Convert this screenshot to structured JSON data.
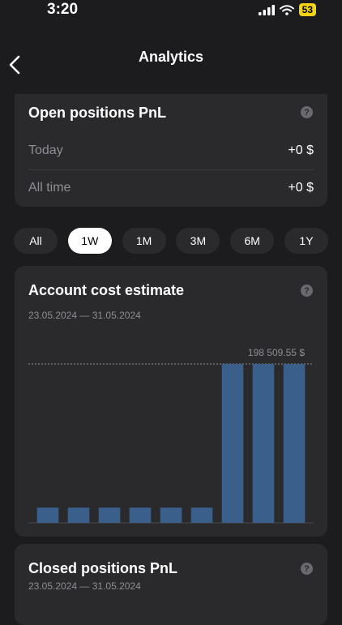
{
  "status_bar": {
    "time": "3:20",
    "battery": "53"
  },
  "nav": {
    "title": "Analytics"
  },
  "open_positions": {
    "title": "Open positions PnL",
    "help": "?",
    "rows": [
      {
        "label": "Today",
        "value": "+0 $"
      },
      {
        "label": "All time",
        "value": "+0 $"
      }
    ]
  },
  "period_tabs": [
    {
      "label": "All"
    },
    {
      "label": "1W",
      "active": true
    },
    {
      "label": "1M"
    },
    {
      "label": "3M"
    },
    {
      "label": "6M"
    },
    {
      "label": "1Y"
    }
  ],
  "account_cost": {
    "title": "Account cost estimate",
    "help": "?",
    "date_range": "23.05.2024 — 31.05.2024",
    "max_label": "198 509.55 $"
  },
  "chart_data": {
    "type": "bar",
    "values": [
      19000,
      19000,
      19000,
      19000,
      19000,
      19000,
      198509.55,
      198509.55,
      198509.55
    ],
    "ylim": [
      0,
      198509.55
    ],
    "grid": false,
    "bar_color": "#3a5f8a",
    "reference_line": 198509.55
  },
  "closed_positions": {
    "title": "Closed positions PnL",
    "help": "?",
    "date_range": "23.05.2024 — 31.05.2024"
  }
}
